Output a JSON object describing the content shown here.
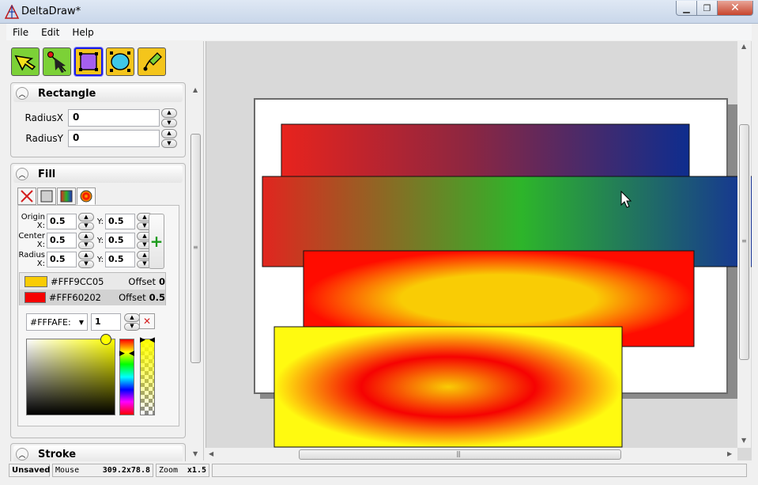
{
  "window": {
    "title": "DeltaDraw*"
  },
  "menu": {
    "items": [
      "File",
      "Edit",
      "Help"
    ]
  },
  "tools": [
    {
      "name": "select-tool",
      "icon": "arrow-select-icon"
    },
    {
      "name": "node-tool",
      "icon": "node-edit-icon"
    },
    {
      "name": "rectangle-tool",
      "icon": "rectangle-icon",
      "selected": true
    },
    {
      "name": "ellipse-tool",
      "icon": "ellipse-icon"
    },
    {
      "name": "pen-tool",
      "icon": "pen-icon"
    }
  ],
  "rectangle_panel": {
    "title": "Rectangle",
    "radius_x_label": "RadiusX",
    "radius_x": "0",
    "radius_y_label": "RadiusY",
    "radius_y": "0"
  },
  "fill_panel": {
    "title": "Fill",
    "origin_x_label": "Origin X:",
    "origin_x": "0.5",
    "origin_y_label": "Y:",
    "origin_y": "0.5",
    "center_x_label": "Center X:",
    "center_x": "0.5",
    "center_y_label": "Y:",
    "center_y": "0.5",
    "radius_x_label": "Radius X:",
    "radius_x": "0.5",
    "radius_y_label": "Y:",
    "radius_y": "0.5",
    "stops": [
      {
        "color": "#FFF9CC05",
        "swatch": "#f9cc05",
        "offset_label": "Offset",
        "offset": "0"
      },
      {
        "color": "#FFF60202",
        "swatch": "#f60202",
        "offset_label": "Offset",
        "offset": "0.5"
      }
    ],
    "current_color": "#FFFAFE:",
    "current_offset": "1"
  },
  "stroke_panel": {
    "title": "Stroke"
  },
  "status": {
    "unsaved": "Unsaved",
    "mouse_label": "Mouse",
    "mouse_value": "309.2x78.8",
    "zoom_label": "Zoom",
    "zoom_value": "x1.5"
  }
}
